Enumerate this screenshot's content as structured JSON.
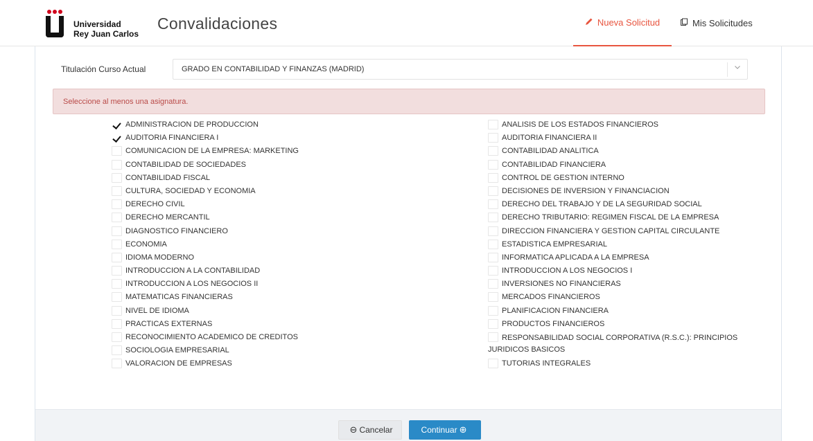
{
  "brand": {
    "logo_line1": "Universidad",
    "logo_line2": "Rey Juan Carlos",
    "logo_color": "#d0021b"
  },
  "app": {
    "title": "Convalidaciones"
  },
  "nav": {
    "new_request": "Nueva Solicitud",
    "my_requests": "Mis Solicitudes",
    "active_color": "#e8553f",
    "new_icon": "pencil-icon",
    "mine_icon": "clipboard-icon"
  },
  "form": {
    "degree_label": "Titulación Curso Actual",
    "degree_value": "GRADO EN CONTABILIDAD Y FINANZAS (MADRID)"
  },
  "alert": {
    "message": "Seleccione al menos una asignatura.",
    "background": "#f2dede",
    "text_color": "#b94a48"
  },
  "subjects_left": [
    {
      "label": "ADMINISTRACION DE PRODUCCION",
      "checked": true
    },
    {
      "label": "AUDITORIA FINANCIERA I",
      "checked": true
    },
    {
      "label": "COMUNICACION DE LA EMPRESA: MARKETING",
      "checked": false
    },
    {
      "label": "CONTABILIDAD DE SOCIEDADES",
      "checked": false
    },
    {
      "label": "CONTABILIDAD FISCAL",
      "checked": false
    },
    {
      "label": "CULTURA, SOCIEDAD Y ECONOMIA",
      "checked": false
    },
    {
      "label": "DERECHO CIVIL",
      "checked": false
    },
    {
      "label": "DERECHO MERCANTIL",
      "checked": false
    },
    {
      "label": "DIAGNOSTICO FINANCIERO",
      "checked": false
    },
    {
      "label": "ECONOMIA",
      "checked": false
    },
    {
      "label": "IDIOMA MODERNO",
      "checked": false
    },
    {
      "label": "INTRODUCCION A LA CONTABILIDAD",
      "checked": false
    },
    {
      "label": "INTRODUCCION A LOS NEGOCIOS II",
      "checked": false
    },
    {
      "label": "MATEMATICAS FINANCIERAS",
      "checked": false
    },
    {
      "label": "NIVEL DE IDIOMA",
      "checked": false
    },
    {
      "label": "PRACTICAS EXTERNAS",
      "checked": false
    },
    {
      "label": "RECONOCIMIENTO ACADEMICO DE CREDITOS",
      "checked": false
    },
    {
      "label": "SOCIOLOGIA EMPRESARIAL",
      "checked": false
    },
    {
      "label": "VALORACION DE EMPRESAS",
      "checked": false
    }
  ],
  "subjects_right": [
    {
      "label": "ANALISIS DE LOS ESTADOS FINANCIEROS",
      "checked": false
    },
    {
      "label": "AUDITORIA FINANCIERA II",
      "checked": false
    },
    {
      "label": "CONTABILIDAD ANALITICA",
      "checked": false
    },
    {
      "label": "CONTABILIDAD FINANCIERA",
      "checked": false
    },
    {
      "label": "CONTROL DE GESTION INTERNO",
      "checked": false
    },
    {
      "label": "DECISIONES DE INVERSION Y FINANCIACION",
      "checked": false
    },
    {
      "label": "DERECHO DEL TRABAJO Y DE LA SEGURIDAD SOCIAL",
      "checked": false
    },
    {
      "label": "DERECHO TRIBUTARIO: REGIMEN FISCAL DE LA EMPRESA",
      "checked": false
    },
    {
      "label": "DIRECCION FINANCIERA Y GESTION CAPITAL CIRCULANTE",
      "checked": false
    },
    {
      "label": "ESTADISTICA EMPRESARIAL",
      "checked": false
    },
    {
      "label": "INFORMATICA APLICADA A LA EMPRESA",
      "checked": false
    },
    {
      "label": "INTRODUCCION A LOS NEGOCIOS I",
      "checked": false
    },
    {
      "label": "INVERSIONES NO FINANCIERAS",
      "checked": false
    },
    {
      "label": "MERCADOS FINANCIEROS",
      "checked": false
    },
    {
      "label": "PLANIFICACION FINANCIERA",
      "checked": false
    },
    {
      "label": "PRODUCTOS FINANCIEROS",
      "checked": false
    },
    {
      "label": "RESPONSABILIDAD SOCIAL CORPORATIVA (R.S.C.): PRINCIPIOS JURIDICOS BASICOS",
      "checked": false
    },
    {
      "label": "TUTORIAS INTEGRALES",
      "checked": false
    }
  ],
  "footer": {
    "cancel_label": "Cancelar",
    "continue_label": "Continuar",
    "cancel_icon": "arrow-left-circle-icon",
    "continue_icon": "arrow-right-circle-icon",
    "primary_color": "#2a8ac7"
  }
}
